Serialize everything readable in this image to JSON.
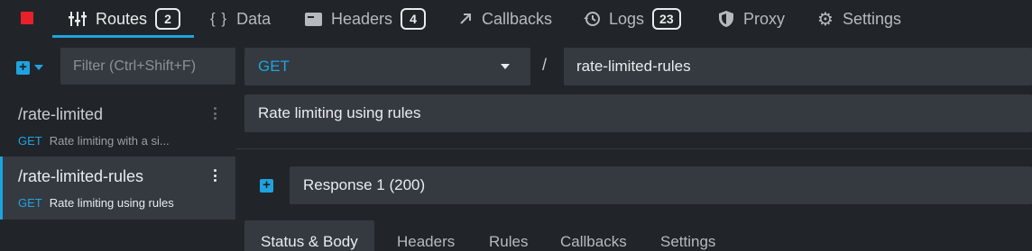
{
  "tabs": [
    {
      "label": "Routes",
      "badge": "2",
      "icon": "routes-icon"
    },
    {
      "label": "Data",
      "icon": "braces-icon"
    },
    {
      "label": "Headers",
      "badge": "4",
      "icon": "headers-icon"
    },
    {
      "label": "Callbacks",
      "icon": "arrow-up-right-icon"
    },
    {
      "label": "Logs",
      "badge": "23",
      "icon": "history-icon"
    },
    {
      "label": "Proxy",
      "icon": "shield-icon"
    },
    {
      "label": "Settings",
      "icon": "gear-icon"
    }
  ],
  "colors": {
    "accent": "#1fa3e0",
    "stop": "#e8202a"
  },
  "sidebar": {
    "filter_placeholder": "Filter (Ctrl+Shift+F)",
    "routes": [
      {
        "path": "/rate-limited",
        "method": "GET",
        "description": "Rate limiting with a si..."
      },
      {
        "path": "/rate-limited-rules",
        "method": "GET",
        "description": "Rate limiting using rules"
      }
    ]
  },
  "route": {
    "method": "GET",
    "separator": "/",
    "path": "rate-limited-rules",
    "documentation": "Rate limiting using rules"
  },
  "response": {
    "label": "Response 1 (200)"
  },
  "response_tabs": [
    "Status & Body",
    "Headers",
    "Rules",
    "Callbacks",
    "Settings"
  ]
}
